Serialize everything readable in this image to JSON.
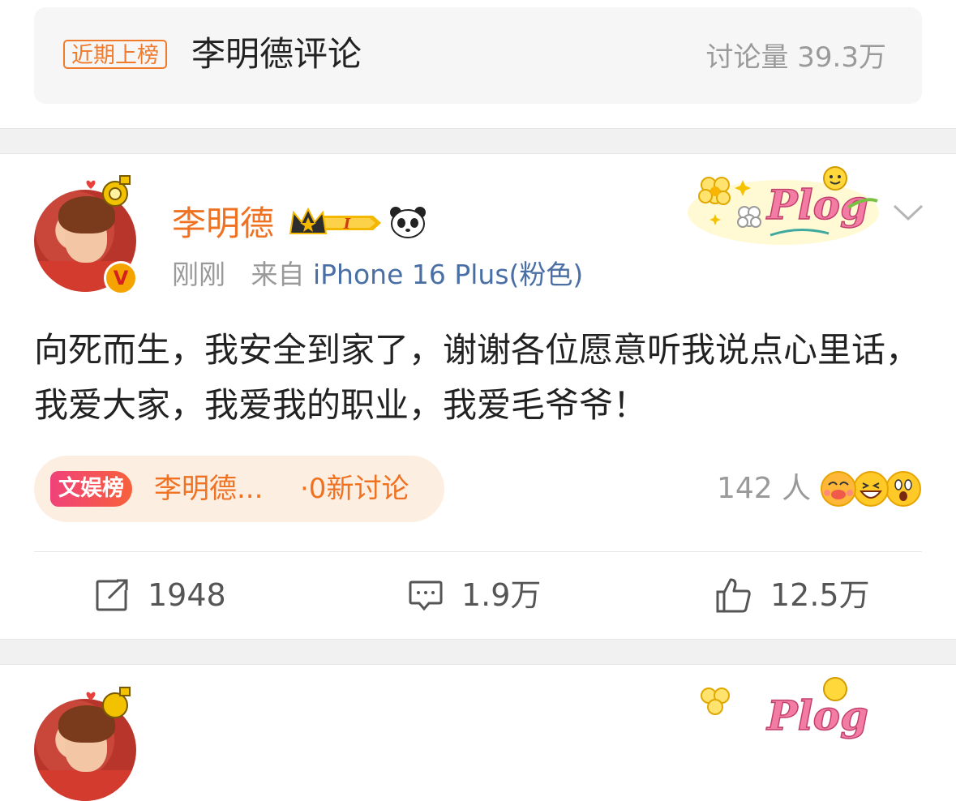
{
  "topic_bar": {
    "tag": "近期上榜",
    "title": "李明德评论",
    "count": "讨论量 39.3万"
  },
  "post": {
    "username": "李明德",
    "time": "刚刚",
    "source_prefix": "来自",
    "source": "iPhone 16 Plus(粉色)",
    "verify_mark": "V",
    "content": "向死而生，我安全到家了，谢谢各位愿意听我说点心里话，我爱大家，我爱我的职业，我爱毛爷爷！",
    "hot": {
      "label": "文娱榜",
      "topic": "李明德...",
      "count": "·0新讨论"
    },
    "reactors": "142 人",
    "actions": {
      "repost": "1948",
      "comment": "1.9万",
      "like": "12.5万"
    }
  },
  "colors": {
    "accent_orange": "#ef7222",
    "link_blue": "#4a6fa5",
    "muted": "#9a9a9a"
  }
}
